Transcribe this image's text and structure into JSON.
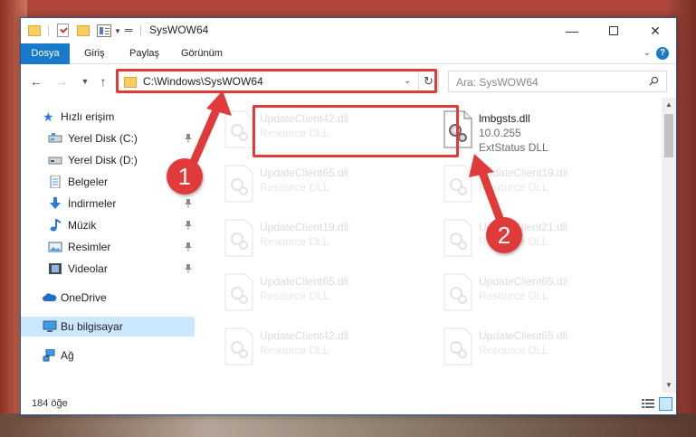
{
  "window": {
    "title": "SysWOW64",
    "controls": {
      "minimize": "—",
      "close": "✕"
    }
  },
  "ribbon": {
    "tabs": [
      "Dosya",
      "Giriş",
      "Paylaş",
      "Görünüm"
    ]
  },
  "address_bar": {
    "path": "C:\\Windows\\SysWOW64",
    "search_placeholder": "Ara: SysWOW64"
  },
  "sidebar": {
    "items": [
      {
        "label": "Hızlı erişim",
        "icon": "star-icon",
        "pinned": false
      },
      {
        "label": "Yerel Disk (C:)",
        "icon": "drive-icon",
        "pinned": true
      },
      {
        "label": "Yerel Disk (D:)",
        "icon": "drive-icon",
        "pinned": true
      },
      {
        "label": "Belgeler",
        "icon": "documents-icon",
        "pinned": true
      },
      {
        "label": "İndirmeler",
        "icon": "downloads-icon",
        "pinned": true
      },
      {
        "label": "Müzik",
        "icon": "music-icon",
        "pinned": true
      },
      {
        "label": "Resimler",
        "icon": "pictures-icon",
        "pinned": true
      },
      {
        "label": "Videolar",
        "icon": "videos-icon",
        "pinned": true
      },
      {
        "label": "OneDrive",
        "icon": "cloud-icon",
        "pinned": false
      },
      {
        "label": "Bu bilgisayar",
        "icon": "computer-icon",
        "pinned": false,
        "selected": true
      },
      {
        "label": "Ağ",
        "icon": "network-icon",
        "pinned": false
      }
    ]
  },
  "files": {
    "highlighted": {
      "name": "lmbgsts.dll",
      "version": "10.0.255",
      "type": "ExtStatus DLL"
    },
    "left_column": [
      {
        "name": "UpdateClient42.dll",
        "type": "Resource DLL"
      },
      {
        "name": "UpdateClient65.dll",
        "type": "Resource DLL"
      },
      {
        "name": "UpdateClient19.dll",
        "type": "Resource DLL"
      },
      {
        "name": "UpdateClient65.dll",
        "type": "Resource DLL"
      },
      {
        "name": "UpdateClient42.dll",
        "type": "Resource DLL"
      }
    ],
    "right_column": [
      {
        "name": "UpdateClient19.dll",
        "type": "Resource DLL"
      },
      {
        "name": "UpdateClient21.dll",
        "type": "Resource DLL"
      },
      {
        "name": "UpdateClient65.dll",
        "type": "Resource DLL"
      },
      {
        "name": "UpdateClient65.dll",
        "type": "Resource DLL"
      }
    ]
  },
  "status": {
    "item_count": "184 öğe"
  },
  "annotations": {
    "step1": "1",
    "step2": "2",
    "color": "#e03a3a"
  }
}
